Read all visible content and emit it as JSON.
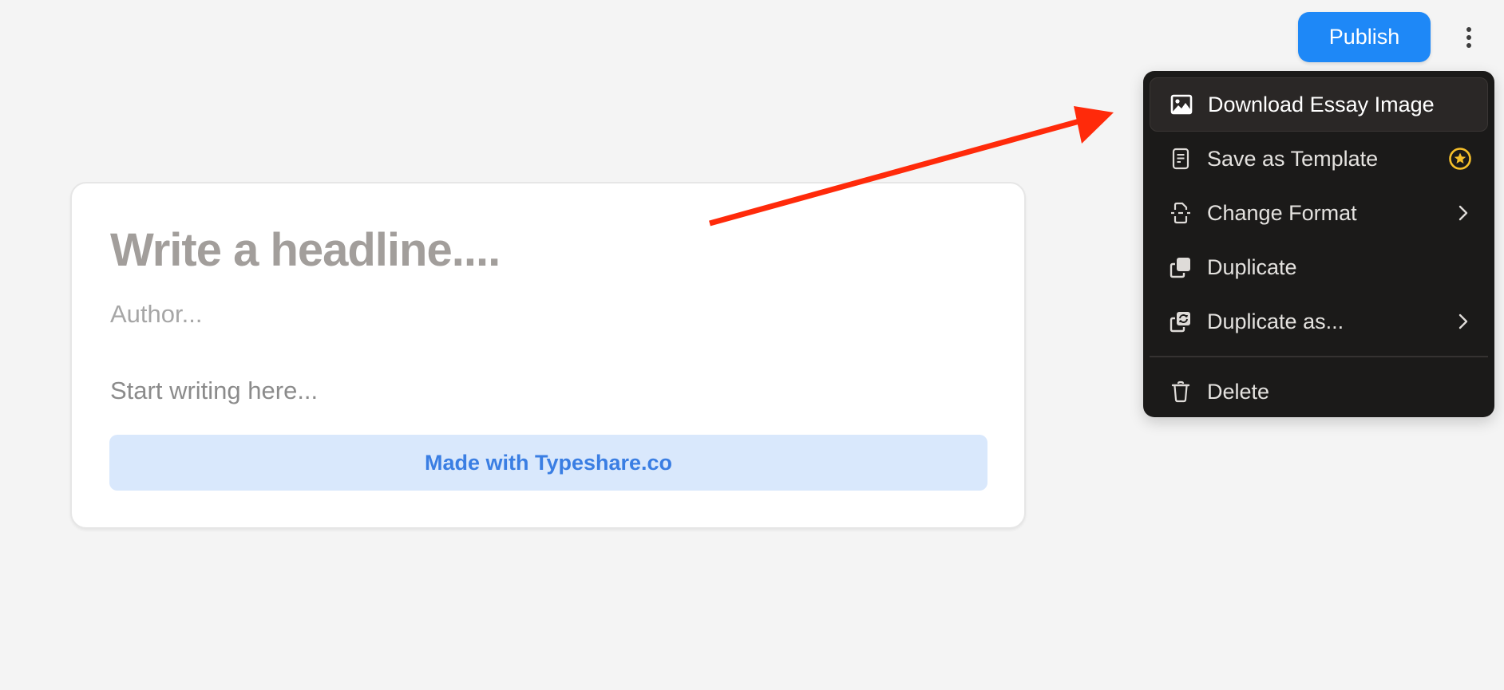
{
  "header": {
    "publish_label": "Publish",
    "more_menu_icon": "more-vertical-icon"
  },
  "editor": {
    "headline_placeholder": "Write a headline....",
    "author_placeholder": "Author...",
    "body_placeholder": "Start writing here...",
    "footer_banner": "Made with Typeshare.co"
  },
  "menu": {
    "items": [
      {
        "label": "Download Essay Image",
        "icon": "image-icon",
        "active": true
      },
      {
        "label": "Save as Template",
        "icon": "document-icon",
        "trailing": "premium-star-badge"
      },
      {
        "label": "Change Format",
        "icon": "format-icon",
        "trailing": "chevron-right-icon"
      },
      {
        "label": "Duplicate",
        "icon": "duplicate-icon"
      },
      {
        "label": "Duplicate as...",
        "icon": "duplicate-convert-icon",
        "trailing": "chevron-right-icon"
      },
      {
        "label": "Delete",
        "icon": "trash-icon"
      }
    ]
  },
  "annotation": {
    "type": "arrow",
    "color": "#ff2a0a",
    "points_to": "Download Essay Image"
  },
  "colors": {
    "publish": "#1e88f7",
    "banner_bg": "#d9e8fc",
    "banner_text": "#3a7ee3",
    "menu_bg": "#1b1a19",
    "premium_star": "#f5bf2a"
  }
}
